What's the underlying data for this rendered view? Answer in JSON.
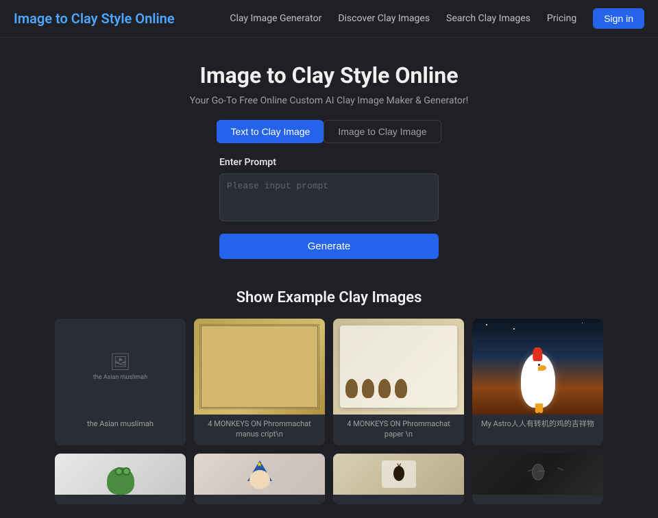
{
  "nav": {
    "logo": "Image to Clay Style Online",
    "links": [
      {
        "id": "clay-image-generator",
        "label": "Clay Image Generator"
      },
      {
        "id": "discover-clay-images",
        "label": "Discover Clay Images"
      },
      {
        "id": "search-clay-images",
        "label": "Search Clay Images"
      },
      {
        "id": "pricing",
        "label": "Pricing"
      }
    ],
    "signin_label": "Sign in"
  },
  "hero": {
    "title": "Image to Clay Style Online",
    "subtitle": "Your Go-To Free Online Custom AI Clay Image Maker & Generator!",
    "tab_text_to_clay": "Text to Clay Image",
    "tab_image_to_clay": "Image to Clay Image",
    "form_label": "Enter Prompt",
    "prompt_placeholder": "Please input prompt",
    "generate_button": "Generate",
    "gallery_heading": "Show Example Clay Images"
  },
  "gallery": {
    "row1": [
      {
        "id": "asian-muslimah",
        "alt": "the Asian muslimah",
        "caption": "the Asian muslimah",
        "style": "broken"
      },
      {
        "id": "monkeys-manuscript",
        "alt": "4 MONKEYS ON Phrommachat manuscript",
        "caption": "4 MONKEYS ON Phrommachat manus cript\\n",
        "style": "manuscript"
      },
      {
        "id": "monkeys-paper",
        "alt": "4 MONKEYS ON Phrommachat paper",
        "caption": "4 MONKEYS ON Phrommachat paper \\n",
        "style": "monkeys-paper"
      },
      {
        "id": "rooster",
        "alt": "My Astro rooster",
        "caption": "My Astro人人有转机的鸡的吉祥物",
        "style": "rooster"
      }
    ],
    "row2": [
      {
        "id": "frog",
        "alt": "clay frog",
        "caption": "",
        "style": "frog"
      },
      {
        "id": "clown",
        "alt": "clay clown",
        "caption": "",
        "style": "clown"
      },
      {
        "id": "bug-paper",
        "alt": "clay bug on paper",
        "caption": "",
        "style": "bug-paper"
      },
      {
        "id": "bug-black",
        "alt": "clay bug dark",
        "caption": "",
        "style": "bug-black"
      }
    ]
  }
}
